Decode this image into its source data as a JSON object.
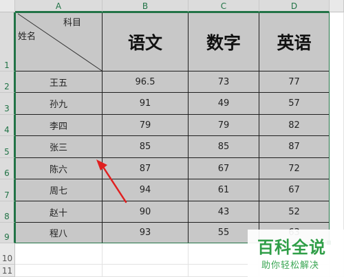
{
  "columns": [
    "A",
    "B",
    "C",
    "D"
  ],
  "rows": [
    "1",
    "2",
    "3",
    "4",
    "5",
    "6",
    "7",
    "8",
    "9",
    "10",
    "11"
  ],
  "header": {
    "subject_label": "科目",
    "name_label": "姓名",
    "subjects": [
      "语文",
      "数字",
      "英语"
    ]
  },
  "records": [
    {
      "name": "王五",
      "scores": [
        "96.5",
        "73",
        "77"
      ]
    },
    {
      "name": "孙九",
      "scores": [
        "91",
        "49",
        "57"
      ]
    },
    {
      "name": "李四",
      "scores": [
        "79",
        "79",
        "82"
      ]
    },
    {
      "name": "张三",
      "scores": [
        "85",
        "85",
        "87"
      ]
    },
    {
      "name": "陈六",
      "scores": [
        "87",
        "67",
        "72"
      ]
    },
    {
      "name": "周七",
      "scores": [
        "94",
        "61",
        "67"
      ]
    },
    {
      "name": "赵十",
      "scores": [
        "90",
        "43",
        "52"
      ]
    },
    {
      "name": "程八",
      "scores": [
        "93",
        "55",
        "63"
      ]
    }
  ],
  "colors": {
    "selection": "#217346",
    "table_fill": "#c8c8c8",
    "arrow": "#e02020",
    "watermark": "#2f9e47"
  },
  "watermark": {
    "title": "百科全说",
    "subtitle": "助你轻松解决"
  }
}
